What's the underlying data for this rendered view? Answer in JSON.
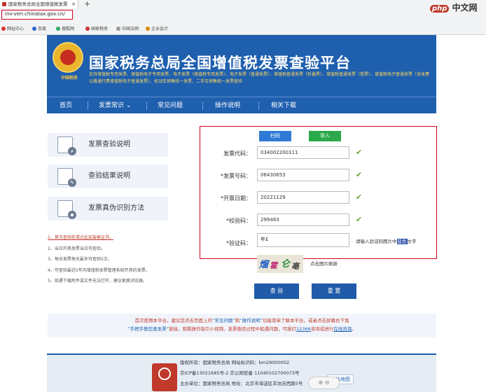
{
  "browser": {
    "tab_title": "国家税务总局全国增值税发票",
    "tab_close": "×",
    "new_tab": "+",
    "address": "inv-veri.chinatax.gov.cn/",
    "bookmarks": [
      "网址中心",
      "百度",
      "搜狐网",
      "国家税务",
      "中国法网",
      "企业会计"
    ],
    "watermark_brand": "php",
    "watermark_text": "中文网"
  },
  "header": {
    "emblem_caption": "中国税务",
    "title": "国家税务总局全国增值税发票查验平台",
    "subtitle": "支持增值税专用发票、增值税电子专用发票、电子发票（增值税专用发票）、电子发票（普通发票）、增值税普通发票（折叠票）、增值税普通发票（卷票）、增值税电子普通发票（含收费公路通行费增值税电子普通发票）、机动车销售统一发票、二手车销售统一发票查验"
  },
  "nav": {
    "items": [
      "首页",
      "发票常识",
      "常见问题",
      "操作说明",
      "相关下载"
    ],
    "dropdown_caret": "⌄"
  },
  "sidebar": {
    "items": [
      "发票查验说明",
      "查验结果说明",
      "发票真伪识别方法"
    ]
  },
  "notes": [
    "1、首次查验前请点此安装根证书。",
    "2、当日开具发票当日可查验。",
    "3、每份发票每天最多可查验5次。",
    "4、可查验最近5年内增值税发票管理系统开具的发票。",
    "5、如遇下载附件或文件无法打开，建议更换浏览器。"
  ],
  "form": {
    "scan_label": "扫码",
    "import_label": "导入",
    "fields": [
      {
        "label": "发票代码：",
        "value": "034002200111"
      },
      {
        "label": "*发票号码：",
        "value": "06430653"
      },
      {
        "label": "*开票日期：",
        "value": "20221129"
      },
      {
        "label": "*校验码：",
        "value": "299483"
      },
      {
        "label": "*验证码：",
        "value": "年£"
      }
    ],
    "check_mark": "✔",
    "captcha_hint_prefix": "请输入验证码图片中",
    "captcha_hint_color": "蓝色",
    "captcha_hint_suffix": "文字",
    "captcha_chars": [
      "熘",
      "霍",
      "仑",
      "亳"
    ],
    "refresh_label": "点击图片刷新",
    "check_button": "查 验",
    "reset_button": "重 置"
  },
  "notice": {
    "p1": "首次使用本平台，建议您点击页面上的",
    "k1": "“常见问题”",
    "p2": "和",
    "k2": "“操作说明”",
    "p3": "功能菜单了解本平台，或者点击屏幕右下角",
    "p4": "“手把手教您查发票”",
    "p5": "链接，观看操作指引小视频。发票查验过程中如遇问题，可拨打",
    "phone": "12366",
    "p6": "咨询或进行",
    "link": "在线咨询",
    "p7": "。"
  },
  "footer": {
    "line1": "版权所有：国家税务总局  网站标识码：bm29000002",
    "line2": "京ICP备13021685号-2  京公网安备 11040102700073号",
    "line3": "主办单位：国家税务总局  地址：北京市海淀区羊坊店西路5号",
    "sitemap": "网站地图"
  },
  "overlay": {
    "zoom": "⊕ ⊖"
  }
}
